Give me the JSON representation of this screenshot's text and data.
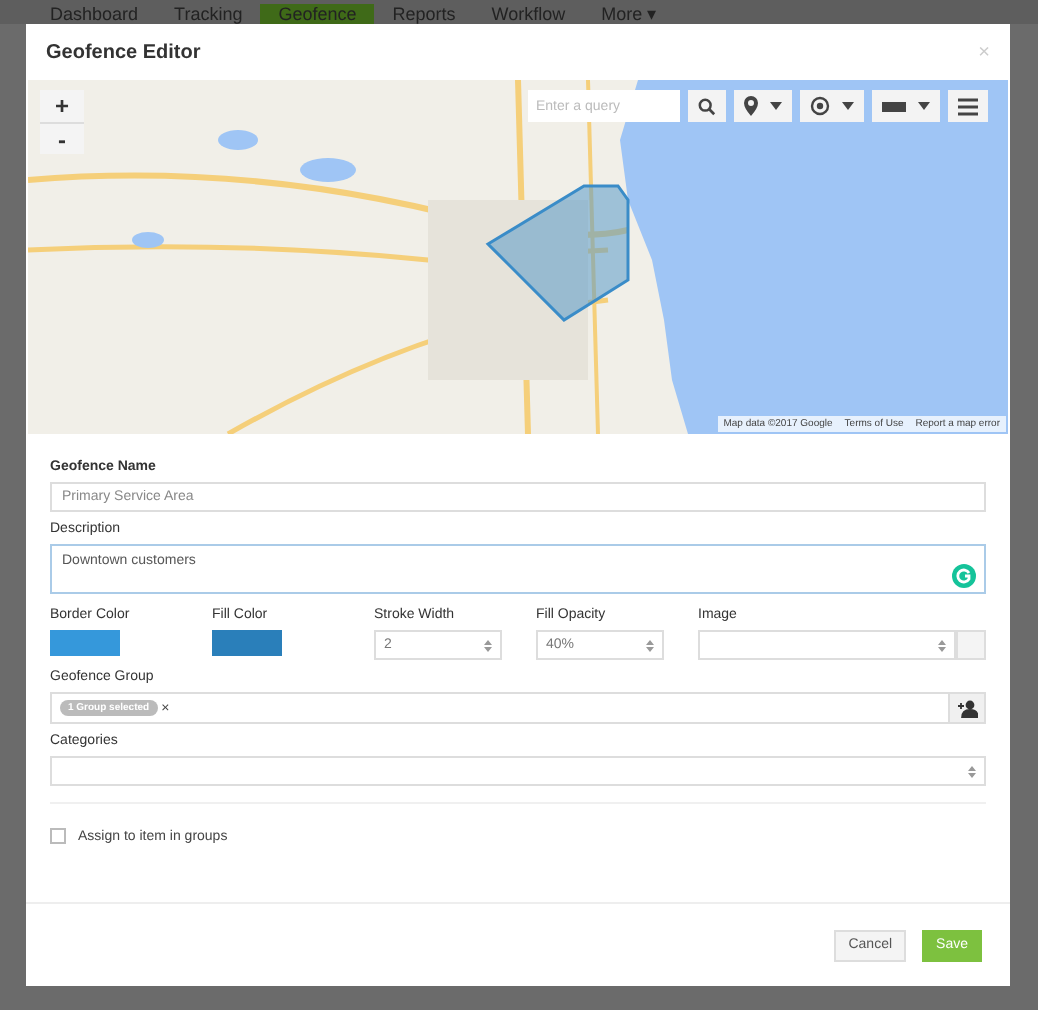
{
  "nav": {
    "tabs": [
      {
        "label": "Dashboard",
        "selected": false
      },
      {
        "label": "Tracking",
        "selected": false
      },
      {
        "label": "Geofence",
        "selected": true
      },
      {
        "label": "Reports",
        "selected": false
      },
      {
        "label": "Workflow",
        "selected": false
      },
      {
        "label": "More ▾",
        "selected": false
      }
    ]
  },
  "dialog": {
    "title": "Geofence Editor",
    "close": "×"
  },
  "map": {
    "zoom_in": "+",
    "zoom_out": "-",
    "search_placeholder": "Enter a query",
    "attribution": [
      "Map data ©2017 Google",
      "Terms of Use",
      "Report a map error"
    ]
  },
  "form": {
    "name_label": "Geofence Name",
    "name_value": "Primary Service Area",
    "description_label": "Description",
    "description_value": "Downtown customers",
    "colors": [
      {
        "label": "Border Color",
        "color": "#3598db"
      },
      {
        "label": "Fill Color",
        "color": "#2a7fba"
      }
    ],
    "selects": [
      {
        "label": "Stroke Width",
        "value": "2"
      },
      {
        "label": "Fill Opacity",
        "value": "40%"
      },
      {
        "label": "Image"
      }
    ],
    "group_label": "Geofence Group",
    "group_chip": "1 Group selected",
    "group_chip_remove": "×",
    "categories_label": "Categories",
    "assign": {
      "label": "Assign to item in groups",
      "checked": false
    }
  },
  "buttons": [
    {
      "label": "Cancel",
      "kind": "default"
    },
    {
      "label": "Save",
      "kind": "primary"
    }
  ]
}
